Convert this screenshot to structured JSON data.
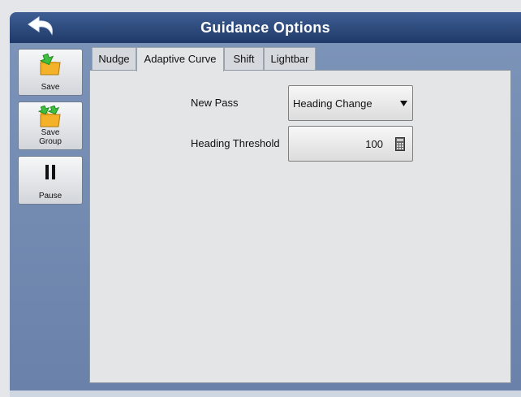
{
  "window": {
    "title": "Guidance Options"
  },
  "sidebar": {
    "save_label": "Save",
    "save_group_label_line1": "Save",
    "save_group_label_line2": "Group",
    "pause_label": "Pause"
  },
  "tabs": [
    "Nudge",
    "Adaptive Curve",
    "Shift",
    "Lightbar"
  ],
  "active_tab": "Adaptive Curve",
  "form": {
    "new_pass_label": "New Pass",
    "new_pass_value": "Heading Change",
    "heading_threshold_label": "Heading Threshold",
    "heading_threshold_value": "100"
  },
  "icons": {
    "back": "back-arrow-icon",
    "save": "folder-save-icon",
    "save_group": "folder-save-group-icon",
    "pause": "pause-icon",
    "dropdown": "triangle-down-icon",
    "calculator": "calculator-icon"
  },
  "colors": {
    "titlebar": "#2b4a7f",
    "body": "#7389af",
    "panel": "#e3e5e7"
  }
}
